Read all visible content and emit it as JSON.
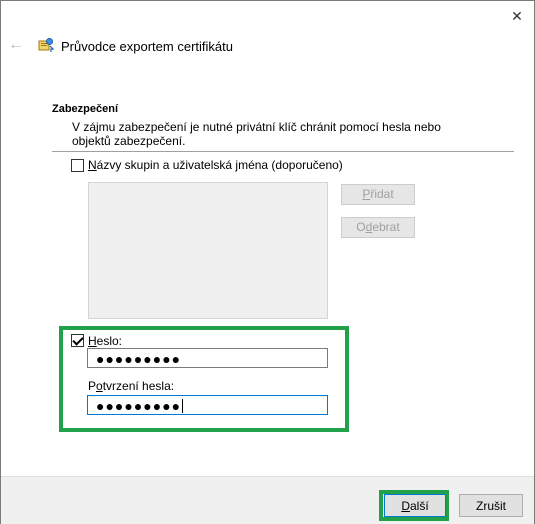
{
  "window": {
    "title": "Průvodce exportem certifikátu",
    "close_icon": "close-icon",
    "back_icon": "back-arrow-icon",
    "wizard_icon": "certificate-wizard-icon"
  },
  "security": {
    "title": "Zabezpečení",
    "description": "V zájmu zabezpečení je nutné privátní klíč chránit pomocí hesla nebo objektů zabezpečení.",
    "groups_checkbox_label": "Názvy skupin a uživatelská jména (doporučeno)",
    "groups_checked": false,
    "add_button": "Přidat",
    "remove_button": "Odebrat",
    "password_checkbox_label": "Heslo:",
    "password_checked": true,
    "password_value": "●●●●●●●●●",
    "confirm_label": "Potvrzení hesla:",
    "confirm_value": "●●●●●●●●●"
  },
  "footer": {
    "next_button": "Další",
    "cancel_button": "Zrušit"
  },
  "colors": {
    "highlight": "#21a14a",
    "focus_border": "#0078d7"
  }
}
